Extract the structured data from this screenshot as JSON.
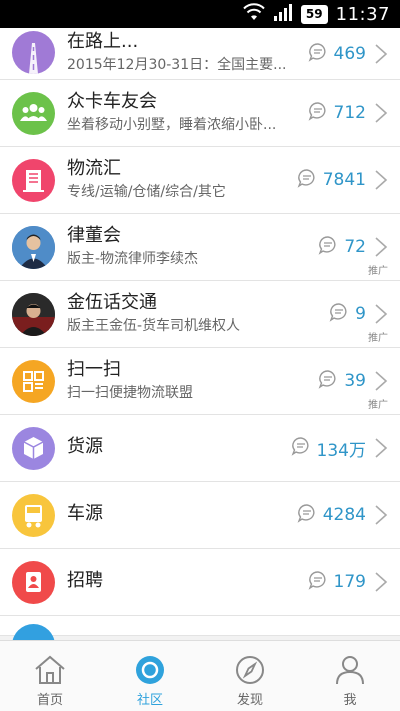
{
  "status_bar": {
    "battery": "59",
    "time": "11:37"
  },
  "list": [
    {
      "title": "在路上...",
      "subtitle": "2015年12月30-31日：全国主要...",
      "count": "469",
      "promo": "",
      "color": "#a07ad6",
      "icon": "road-icon"
    },
    {
      "title": "众卡车友会",
      "subtitle": "坐着移动小别墅，睡着浓缩小卧...",
      "count": "712",
      "promo": "",
      "color": "#6cc24a",
      "icon": "people-icon"
    },
    {
      "title": "物流汇",
      "subtitle": "专线/运输/仓储/综合/其它",
      "count": "7841",
      "promo": "",
      "color": "#f0456c",
      "icon": "building-icon"
    },
    {
      "title": "律董会",
      "subtitle": "版主-物流律师李续杰",
      "count": "72",
      "promo": "推广",
      "color": "#3a78b4",
      "icon": "lawyer-avatar"
    },
    {
      "title": "金伍话交通",
      "subtitle": "版主王金伍-货车司机维权人",
      "count": "9",
      "promo": "推广",
      "color": "#333333",
      "icon": "host-avatar"
    },
    {
      "title": "扫一扫",
      "subtitle": "扫一扫便捷物流联盟",
      "count": "39",
      "promo": "推广",
      "color": "#f5a623",
      "icon": "qr-scan-icon"
    },
    {
      "title": "货源",
      "subtitle": "",
      "count": "134万",
      "promo": "",
      "color": "#9b86e0",
      "icon": "box-icon"
    },
    {
      "title": "车源",
      "subtitle": "",
      "count": "4284",
      "promo": "",
      "color": "#f8c53c",
      "icon": "truck-icon"
    },
    {
      "title": "招聘",
      "subtitle": "",
      "count": "179",
      "promo": "",
      "color": "#f04a4a",
      "icon": "recruit-icon"
    }
  ],
  "tabs": [
    {
      "label": "首页",
      "icon": "home-icon",
      "active": false
    },
    {
      "label": "社区",
      "icon": "community-icon",
      "active": true
    },
    {
      "label": "发现",
      "icon": "compass-icon",
      "active": false
    },
    {
      "label": "我",
      "icon": "profile-icon",
      "active": false
    }
  ]
}
